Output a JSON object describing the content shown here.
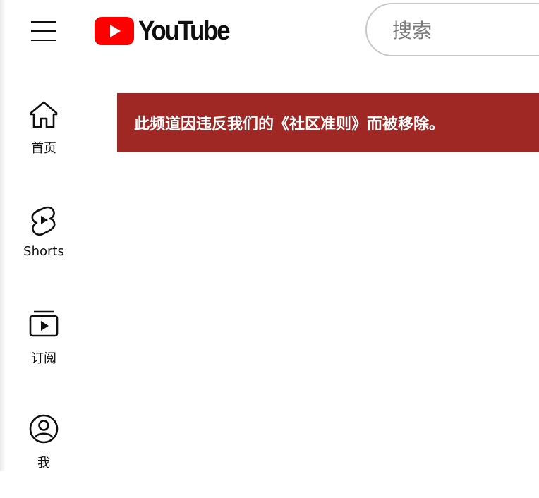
{
  "header": {
    "logo_text": "YouTube",
    "search_placeholder": "搜索"
  },
  "sidebar": {
    "items": [
      {
        "label": "首页",
        "icon": "home-icon"
      },
      {
        "label": "Shorts",
        "icon": "shorts-icon"
      },
      {
        "label": "订阅",
        "icon": "subscriptions-icon"
      },
      {
        "label": "我",
        "icon": "account-icon"
      }
    ]
  },
  "banner": {
    "message": "此频道因违反我们的《社区准则》而被移除。"
  },
  "colors": {
    "brand_red": "#ff0000",
    "banner_red": "#a02824"
  }
}
